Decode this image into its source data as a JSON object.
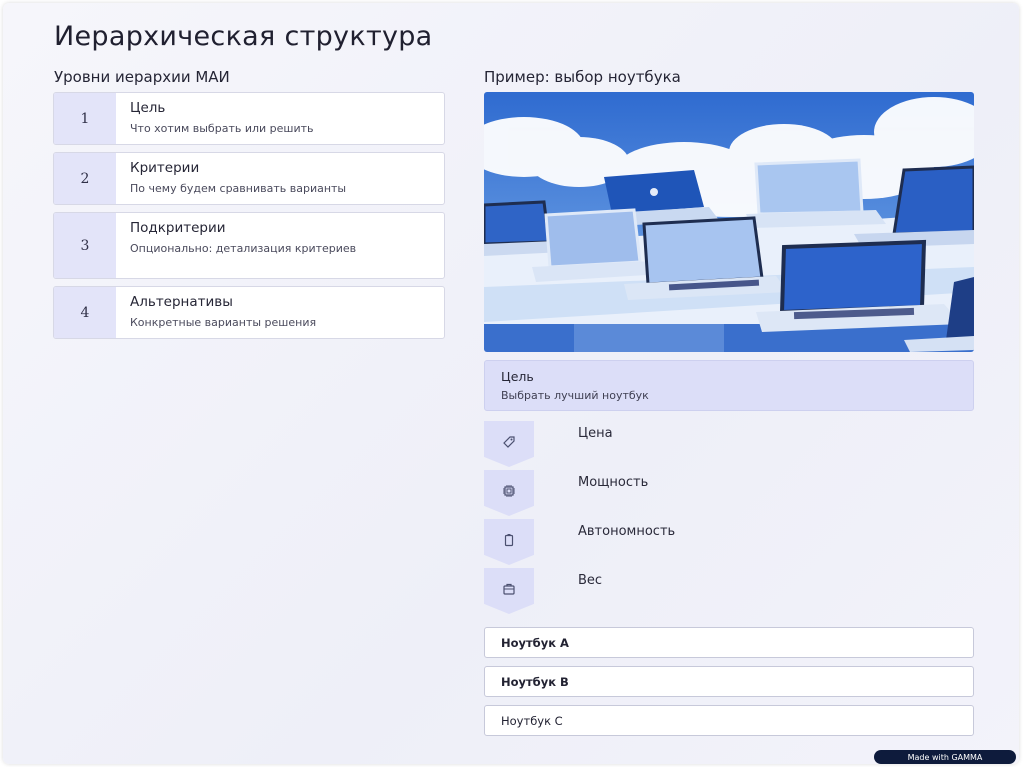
{
  "title": "Иерархическая структура",
  "left_heading": "Уровни иерархии МАИ",
  "right_heading": "Пример: выбор ноутбука",
  "levels": [
    {
      "num": "1",
      "title": "Цель",
      "desc": "Что хотим выбрать или решить"
    },
    {
      "num": "2",
      "title": "Критерии",
      "desc": "По чему будем сравнивать варианты"
    },
    {
      "num": "3",
      "title": "Подкритерии",
      "desc": "Опционально: детализация критериев"
    },
    {
      "num": "4",
      "title": "Альтернативы",
      "desc": "Конкретные варианты решения"
    }
  ],
  "goal": {
    "title": "Цель",
    "desc": "Выбрать лучший ноутбук"
  },
  "criteria": [
    {
      "label": "Цена",
      "icon": "price-tag-icon"
    },
    {
      "label": "Мощность",
      "icon": "cpu-chip-icon"
    },
    {
      "label": "Автономность",
      "icon": "battery-icon"
    },
    {
      "label": "Вес",
      "icon": "weight-icon"
    }
  ],
  "alternatives": [
    {
      "label": "Ноутбук A"
    },
    {
      "label": "Ноутбук B"
    },
    {
      "label": "Ноутбук C"
    }
  ],
  "badge": "Made with GAMMA",
  "colors": {
    "accent_light": "#dcdef8",
    "number_bg": "#e3e4f9",
    "badge_bg": "#0e1b3c",
    "sky": "#3c74cf"
  }
}
